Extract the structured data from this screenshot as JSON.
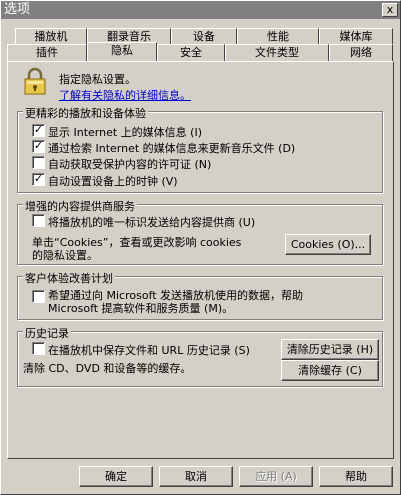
{
  "window": {
    "title": "选项",
    "close_glyph": "x"
  },
  "tabs_row1": [
    "播放机",
    "翻录音乐",
    "设备",
    "性能",
    "媒体库"
  ],
  "tabs_row2": [
    "插件",
    "隐私",
    "安全",
    "文件类型",
    "网络"
  ],
  "active_tab": "隐私",
  "intro": {
    "text": "指定隐私设置。",
    "link": "了解有关隐私的详细信息。"
  },
  "group_enhanced": {
    "title": "更精彩的播放和设备体验",
    "items": [
      {
        "label": "显示 Internet 上的媒体信息 (I)",
        "checked": true
      },
      {
        "label": "通过检索 Internet 的媒体信息来更新音乐文件 (D)",
        "checked": true
      },
      {
        "label": "自动获取受保护内容的许可证 (N)",
        "checked": false
      },
      {
        "label": "自动设置设备上的时钟 (V)",
        "checked": true
      }
    ]
  },
  "group_provider": {
    "title": "增强的内容提供商服务",
    "item": {
      "label": "将播放机的唯一标识发送给内容提供商 (U)",
      "checked": false
    },
    "cookie_text_line1": "单击“Cookies”，查看或更改影响 cookies",
    "cookie_text_line2": "的隐私设置。",
    "cookies_button": "Cookies (O)..."
  },
  "group_ceip": {
    "title": "客户体验改善计划",
    "item_line1": "希望通过向 Microsoft 发送播放机使用的数据，帮助",
    "item_line2": "Microsoft 提高软件和服务质量 (M)。",
    "checked": false
  },
  "group_history": {
    "title": "历史记录",
    "item": {
      "label": "在播放机中保存文件和 URL 历史记录 (S)",
      "checked": false
    },
    "clear_text": "清除 CD、DVD 和设备等的缓存。",
    "clear_history_button": "清除历史记录 (H)",
    "clear_cache_button": "清除缓存 (C)"
  },
  "footer": {
    "ok": "确定",
    "cancel": "取消",
    "apply": "应用 (A)",
    "help": "帮助"
  },
  "check_glyph": "✓"
}
